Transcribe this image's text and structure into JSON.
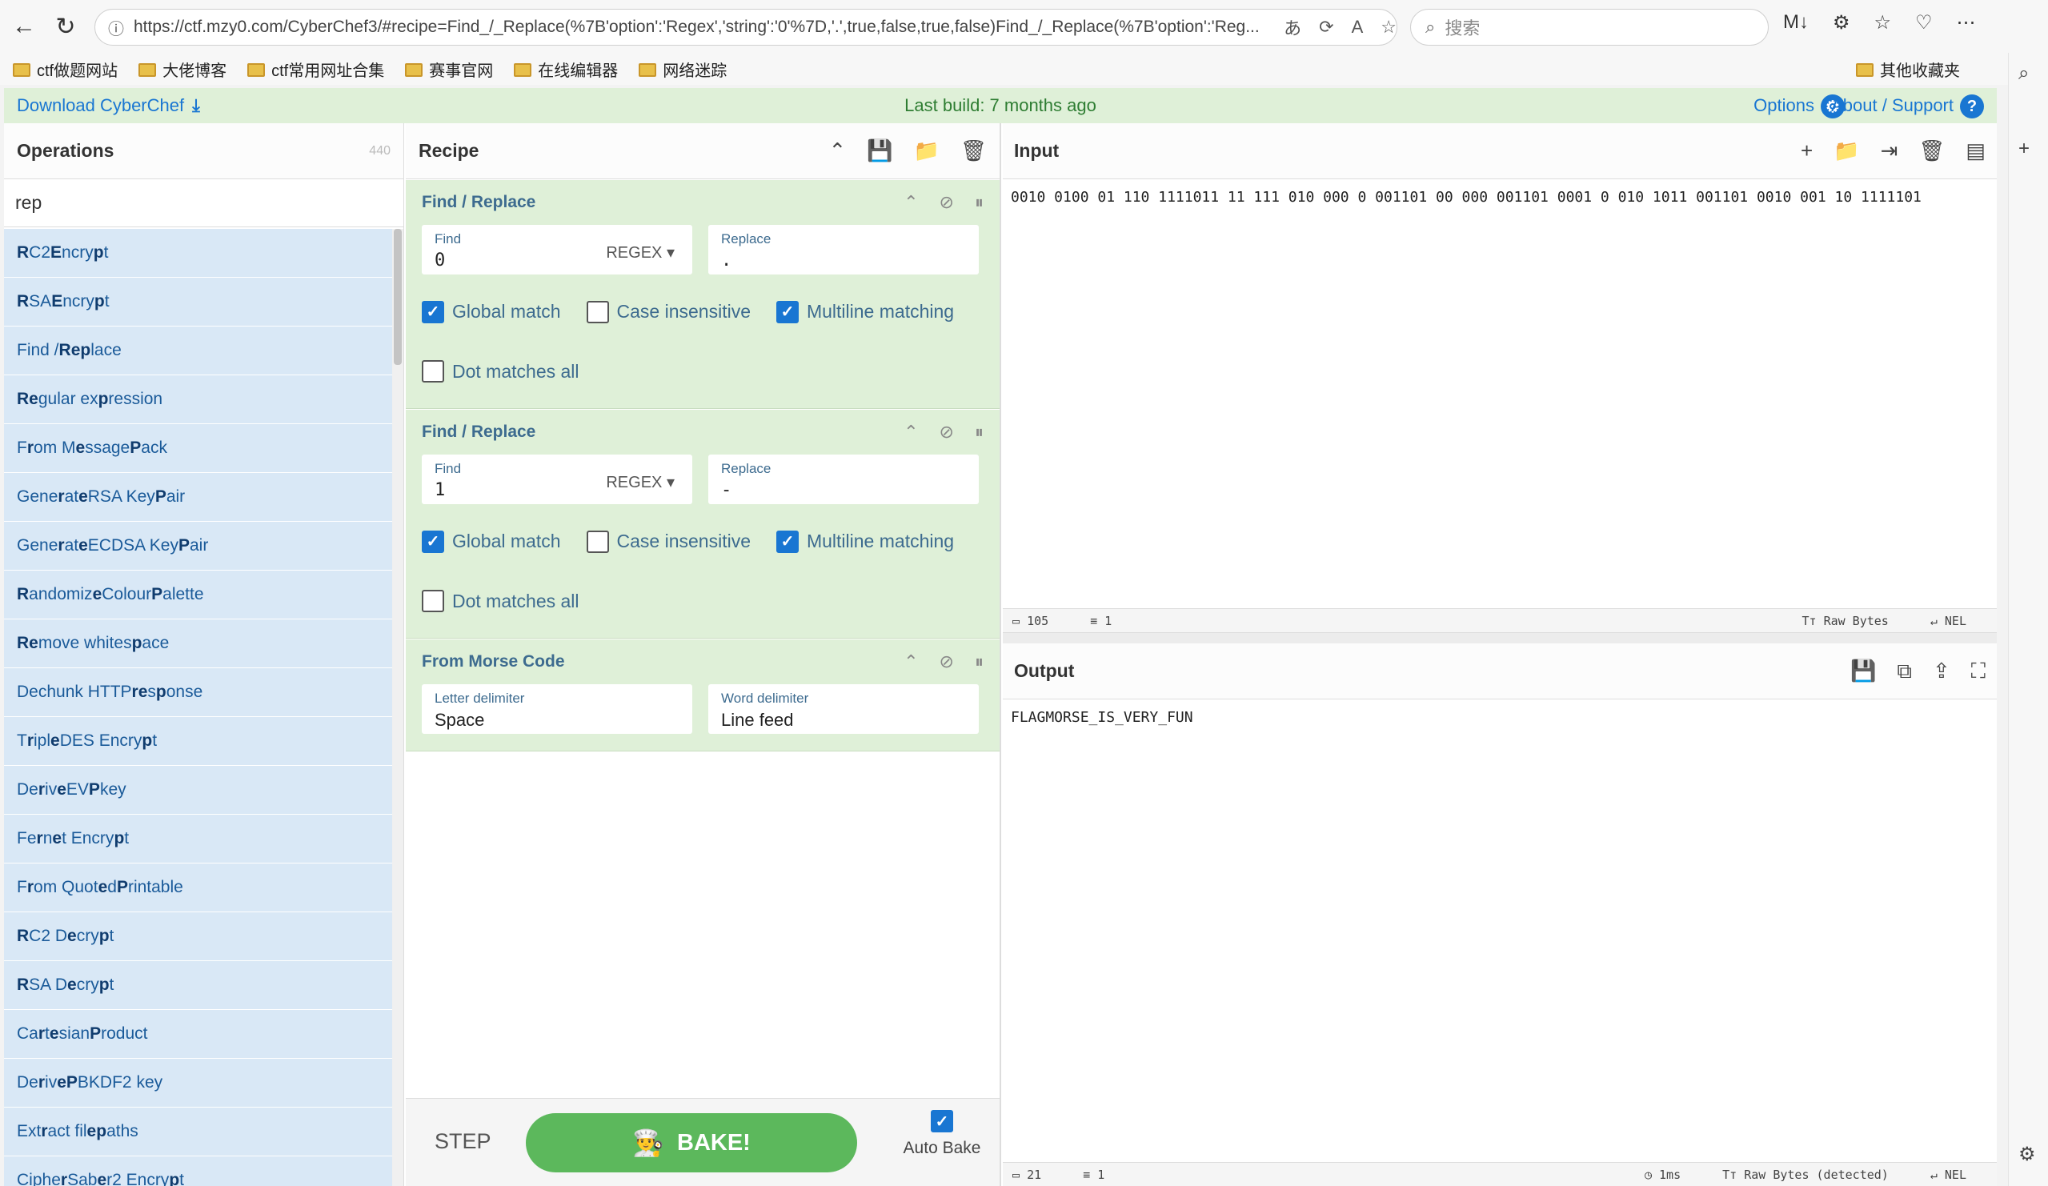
{
  "browser": {
    "url": "https://ctf.mzy0.com/CyberChef3/#recipe=Find_/_Replace(%7B'option':'Regex','string':'0'%7D,'.',true,false,true,false)Find_/_Replace(%7B'option':'Reg...",
    "search_placeholder": "搜索",
    "bookmarks": [
      "ctf做题网站",
      "大佬博客",
      "ctf常用网址合集",
      "赛事官网",
      "在线编辑器",
      "网络迷踪"
    ],
    "other_bookmarks": "其他收藏夹"
  },
  "banner": {
    "download": "Download CyberChef",
    "last_build": "Last build: 7 months ago",
    "options": "Options",
    "about": "About / Support"
  },
  "operations": {
    "title": "Operations",
    "count": "440",
    "search_value": "rep",
    "items": [
      "RC2 Encrypt",
      "RSA Encrypt",
      "Find / Replace",
      "Regular expression",
      "From MessagePack",
      "Generate RSA Key Pair",
      "Generate ECDSA Key Pair",
      "Randomize Colour Palette",
      "Remove whitespace",
      "Dechunk HTTP response",
      "Triple DES Encrypt",
      "Derive EVP key",
      "Fernet Encrypt",
      "From Quoted Printable",
      "RC2 Decrypt",
      "RSA Decrypt",
      "Cartesian Product",
      "Derive PBKDF2 key",
      "Extract file paths",
      "CipherSaber2 Encrypt"
    ]
  },
  "recipe": {
    "title": "Recipe",
    "ops": [
      {
        "name": "Find / Replace",
        "find_label": "Find",
        "find_value": "0",
        "find_mode": "REGEX",
        "replace_label": "Replace",
        "replace_value": ".",
        "global_match": "Global match",
        "case_insensitive": "Case insensitive",
        "multiline": "Multiline matching",
        "dot_all": "Dot matches all"
      },
      {
        "name": "Find / Replace",
        "find_label": "Find",
        "find_value": "1",
        "find_mode": "REGEX",
        "replace_label": "Replace",
        "replace_value": "-",
        "global_match": "Global match",
        "case_insensitive": "Case insensitive",
        "multiline": "Multiline matching",
        "dot_all": "Dot matches all"
      },
      {
        "name": "From Morse Code",
        "letter_label": "Letter delimiter",
        "letter_value": "Space",
        "word_label": "Word delimiter",
        "word_value": "Line feed"
      }
    ],
    "step": "STEP",
    "bake": "BAKE!",
    "auto_bake": "Auto Bake"
  },
  "input": {
    "title": "Input",
    "text": "0010 0100 01 110 1111011 11 111 010 000 0 001101 00 000 001101 0001 0 010 1011 001101 0010 001 10 1111101",
    "length": "105",
    "lines": "1",
    "encoding": "Raw Bytes",
    "eol": "NEL"
  },
  "output": {
    "title": "Output",
    "text": "FLAGMORSE_IS_VERY_FUN",
    "length": "21",
    "lines": "1",
    "time": "1ms",
    "encoding": "Raw Bytes (detected)",
    "eol": "NEL"
  },
  "colors": {
    "accent": "#1976d2",
    "recipe_bg": "#dff0d8",
    "ops_bg": "#d9e8f6",
    "bake": "#5cb85c"
  }
}
